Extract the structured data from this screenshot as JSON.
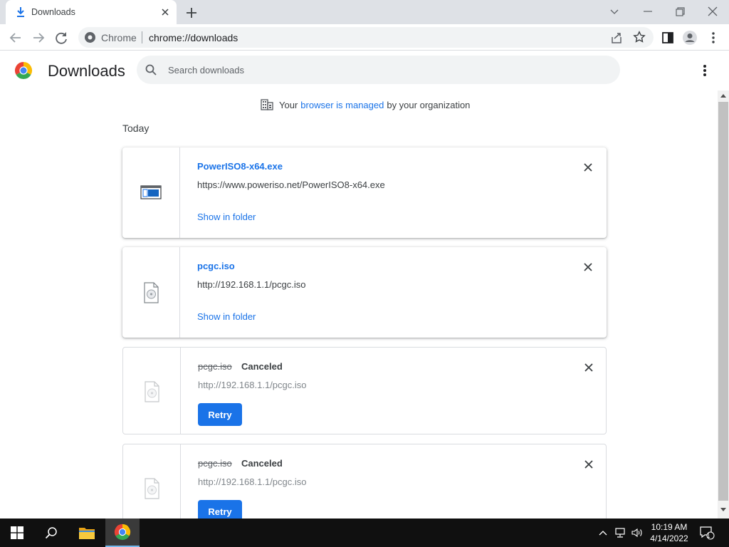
{
  "browser": {
    "tab": {
      "title": "Downloads"
    },
    "omnibox": {
      "chip": "Chrome",
      "url": "chrome://downloads"
    }
  },
  "page": {
    "title": "Downloads",
    "search": {
      "placeholder": "Search downloads",
      "value": ""
    },
    "managed": {
      "prefix": "Your",
      "link": "browser is managed",
      "suffix": "by your organization"
    },
    "date_heading": "Today",
    "downloads": [
      {
        "name": "PowerISO8-x64.exe",
        "url": "https://www.poweriso.net/PowerISO8-x64.exe",
        "action": "Show in folder"
      },
      {
        "name": "pcgc.iso",
        "url": "http://192.168.1.1/pcgc.iso",
        "action": "Show in folder"
      },
      {
        "name": "pcgc.iso",
        "status": "Canceled",
        "url": "http://192.168.1.1/pcgc.iso",
        "action": "Retry"
      },
      {
        "name": "pcgc.iso",
        "status": "Canceled",
        "url": "http://192.168.1.1/pcgc.iso",
        "action": "Retry"
      }
    ]
  },
  "taskbar": {
    "time": "10:19 AM",
    "date": "4/14/2022",
    "notification_count": "1"
  },
  "icons": {
    "tab": [
      "download-icon",
      "close-icon",
      "new-tab-icon"
    ],
    "window": [
      "tab-search-icon",
      "minimize-icon",
      "restore-icon",
      "close-window-icon"
    ],
    "toolbar": [
      "back-icon",
      "forward-icon",
      "reload-icon",
      "site-info-icon",
      "share-icon",
      "star-icon",
      "side-panel-icon",
      "profile-icon",
      "menu-icon"
    ],
    "page": [
      "chrome-logo",
      "search-icon",
      "more-icon",
      "building-icon",
      "exe-file-icon",
      "iso-file-icon",
      "remove-icon"
    ]
  },
  "colors": {
    "accent": "#1a73e8",
    "tabstrip": "#dee1e6",
    "omnibox": "#f1f3f4",
    "taskbar": "#101010"
  }
}
